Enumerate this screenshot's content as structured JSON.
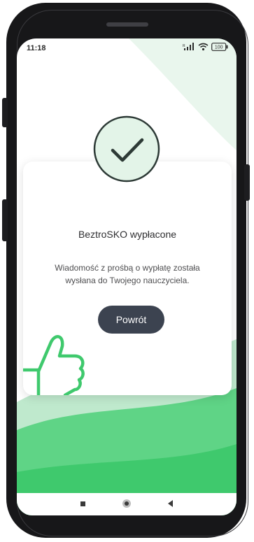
{
  "status_bar": {
    "time": "11:18",
    "battery": "100",
    "network_label": "R"
  },
  "dialog": {
    "title": "BeztroSKO wypłacone",
    "message": "Wiadomość z prośbą o wypłatę została wysłana do Twojego nauczyciela.",
    "button_label": "Powrót"
  },
  "icons": {
    "success": "checkmark-icon",
    "decoration": "thumbs-up-icon",
    "nav": [
      "recent-apps-icon",
      "home-icon",
      "back-icon"
    ]
  },
  "colors": {
    "accent_green": "#3fc96d",
    "light_green": "#e3f4e8",
    "button_dark": "#3c4350",
    "check_stroke": "#2d3a36"
  }
}
